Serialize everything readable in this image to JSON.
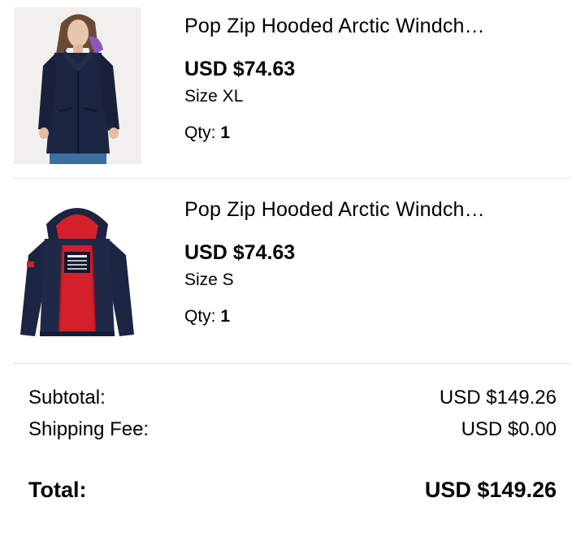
{
  "cart": {
    "items": [
      {
        "name": "Pop Zip Hooded Arctic Windch…",
        "price": "USD $74.63",
        "size": "Size XL",
        "qty_label": "Qty:",
        "qty_value": "1",
        "image": "model-wearing-navy-windcheater-jacket"
      },
      {
        "name": "Pop Zip Hooded Arctic Windch…",
        "price": "USD $74.63",
        "size": "Size S",
        "qty_label": "Qty:",
        "qty_value": "1",
        "image": "navy-jacket-red-lining-product-shot"
      }
    ]
  },
  "summary": {
    "subtotal_label": "Subtotal:",
    "subtotal_value": "USD $149.26",
    "shipping_label": "Shipping Fee:",
    "shipping_value": "USD $0.00",
    "total_label": "Total:",
    "total_value": "USD $149.26"
  },
  "colors": {
    "jacket_navy": "#1b2440",
    "lining_red": "#d3212b",
    "text": "#000000",
    "divider": "#c8c8c8"
  }
}
